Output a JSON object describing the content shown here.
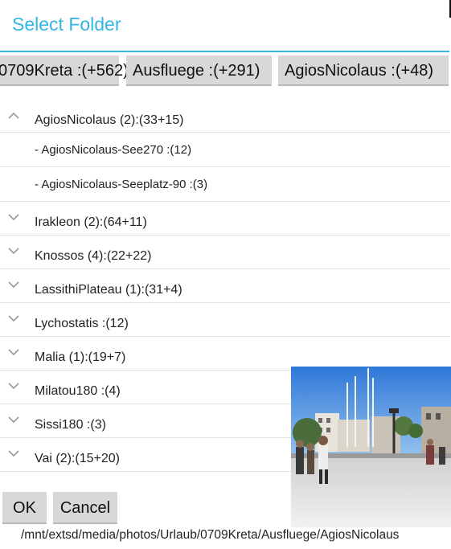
{
  "dialog": {
    "title": "Select Folder"
  },
  "breadcrumbs": [
    {
      "label": "0709Kreta :(+562)"
    },
    {
      "label": "Ausfluege :(+291)"
    },
    {
      "label": "AgiosNicolaus :(+48)"
    }
  ],
  "tree": {
    "expanded_group": {
      "label": "AgiosNicolaus (2):(33+15)",
      "expanded": true,
      "children": [
        {
          "label": "- AgiosNicolaus-See270 :(12)"
        },
        {
          "label": "- AgiosNicolaus-Seeplatz-90 :(3)"
        }
      ]
    },
    "groups": [
      {
        "label": "Irakleon (2):(64+11)"
      },
      {
        "label": "Knossos (4):(22+22)"
      },
      {
        "label": "LassithiPlateau (1):(31+4)"
      },
      {
        "label": "Lychostatis :(12)"
      },
      {
        "label": "Malia (1):(19+7)"
      },
      {
        "label": "Milatou180 :(4)"
      },
      {
        "label": "Sissi180 :(3)"
      },
      {
        "label": "Vai (2):(15+20)"
      }
    ]
  },
  "buttons": {
    "ok": "OK",
    "cancel": "Cancel"
  },
  "status": {
    "path": "/mnt/extsd/media/photos/Urlaub/0709Kreta/Ausfluege/AgiosNicolaus"
  },
  "colors": {
    "accent": "#33b5e5",
    "button_bg": "#d8d8d8",
    "divider": "#e1e1e1"
  }
}
